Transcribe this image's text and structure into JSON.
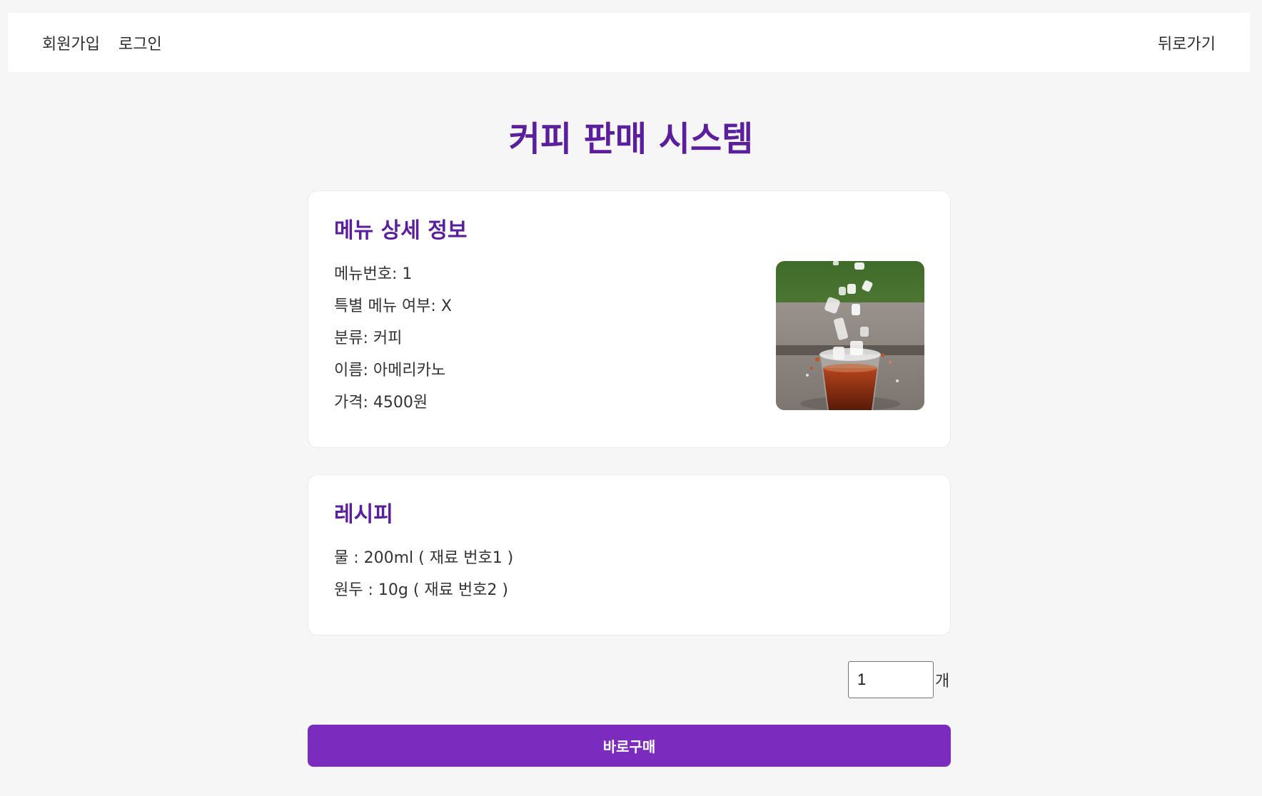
{
  "nav": {
    "signup": "회원가입",
    "login": "로그인",
    "back": "뒤로가기"
  },
  "page_title": "커피 판매 시스템",
  "menu_detail": {
    "title": "메뉴 상세 정보",
    "lines": [
      "메뉴번호: 1",
      "특별 메뉴 여부: X",
      "분류: 커피",
      "이름: 아메리카노",
      "가격: 4500원"
    ],
    "image_icon": "iced-americano-photo"
  },
  "recipe": {
    "title": "레시피",
    "lines": [
      "물 : 200ml ( 재료 번호1 )",
      "원두 : 10g ( 재료 번호2 )"
    ]
  },
  "quantity": {
    "value": "1",
    "unit": "개"
  },
  "buy_button": "바로구매",
  "colors": {
    "accent": "#7b2cbf",
    "title": "#5b1f9e",
    "background": "#f6f6f6"
  }
}
